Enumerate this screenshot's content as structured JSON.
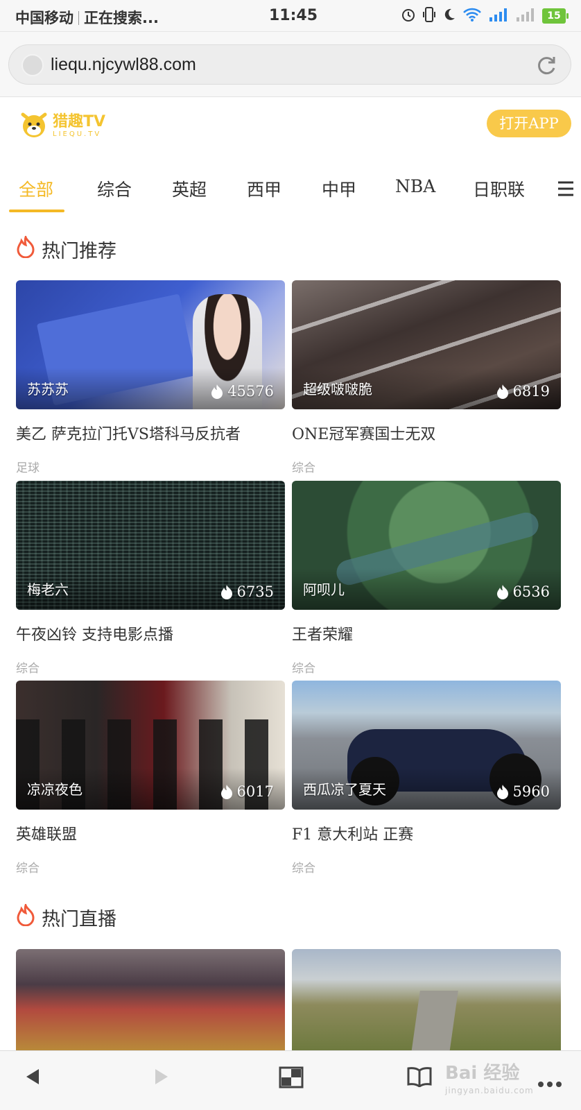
{
  "status_bar": {
    "carrier": "中国移动",
    "status_text": "正在搜索...",
    "time": "11:45",
    "battery": "15",
    "colors": {
      "wifi": "#2d8cf0",
      "signal": "#2d8cf0",
      "battery": "#6fc43b"
    }
  },
  "browser": {
    "url": "liequ.njcywl88.com"
  },
  "header": {
    "logo_text": "猎趣TV",
    "logo_subtext": "LIEQU.TV",
    "open_app_label": "打开APP",
    "colors": {
      "brand": "#f4b925",
      "button": "#f9c94a"
    }
  },
  "tabs": [
    {
      "label": "全部",
      "active": true
    },
    {
      "label": "综合",
      "active": false
    },
    {
      "label": "英超",
      "active": false
    },
    {
      "label": "西甲",
      "active": false
    },
    {
      "label": "中甲",
      "active": false
    },
    {
      "label": "NBA",
      "active": false
    },
    {
      "label": "日职联",
      "active": false
    }
  ],
  "hot_recommend": {
    "title": "热门推荐",
    "cards": [
      {
        "streamer": "苏苏苏",
        "views": "45576",
        "title": "美乙 萨克拉门托VS塔科马反抗者",
        "category": "足球"
      },
      {
        "streamer": "超级啵啵脆",
        "views": "6819",
        "title": "ONE冠军赛国士无双",
        "category": "综合"
      },
      {
        "streamer": "梅老六",
        "views": "6735",
        "title": "午夜凶铃 支持电影点播",
        "category": "综合"
      },
      {
        "streamer": "阿呗儿",
        "views": "6536",
        "title": "王者荣耀",
        "category": "综合"
      },
      {
        "streamer": "凉凉夜色",
        "views": "6017",
        "title": "英雄联盟",
        "category": "综合"
      },
      {
        "streamer": "西瓜凉了夏天",
        "views": "5960",
        "title": "F1 意大利站 正赛",
        "category": "综合"
      }
    ]
  },
  "hot_live": {
    "title": "热门直播"
  },
  "watermark": {
    "text": "Bai 经验",
    "subtext": "jingyan.baidu.com"
  },
  "bottom_nav": {
    "icons": [
      "back-icon",
      "forward-icon",
      "tabs-icon",
      "bookmarks-icon",
      "more-icon"
    ]
  }
}
